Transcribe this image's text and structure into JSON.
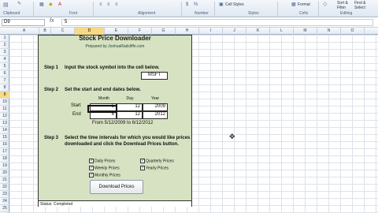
{
  "ribbon": {
    "groups": {
      "clipboard": "Clipboard",
      "font": "Font",
      "alignment": "Alignment",
      "number": "Number",
      "styles": "Styles",
      "cells": "Cells",
      "editing": "Editing"
    },
    "cell_styles": "Cell Styles",
    "format": "Format",
    "sort_filter": "Sort &\nFilter",
    "find_select": "Find &\nSelect"
  },
  "formula_bar": {
    "name_box": "D9",
    "fx": "fx",
    "value": "5"
  },
  "columns": [
    "A",
    "B",
    "C",
    "D",
    "E",
    "F",
    "G",
    "H",
    "I",
    "J",
    "K",
    "L",
    "M",
    "N",
    "O"
  ],
  "rows": [
    "1",
    "2",
    "3",
    "4",
    "5",
    "6",
    "7",
    "8",
    "9",
    "10",
    "11",
    "12",
    "13",
    "14",
    "15",
    "16",
    "17",
    "18",
    "19",
    "20",
    "21",
    "22",
    "23",
    "24",
    "25"
  ],
  "selected_column": "D",
  "selected_row": "9",
  "sheet": {
    "title": "Stock Price Downloader",
    "byline": "Prepared by JoshuaRadcliffe.com",
    "step1": {
      "label": "Step 1",
      "text": "Input the stock symbol into the cell below.",
      "symbol": "MSFT"
    },
    "step2": {
      "label": "Step 2",
      "text": "Set the start and end dates below.",
      "headers": {
        "month": "Month",
        "day": "Day",
        "year": "Year"
      },
      "start": {
        "label": "Start",
        "month": "5",
        "day": "12",
        "year": "2009"
      },
      "end": {
        "label": "End",
        "month": "6",
        "day": "12",
        "year": "2012"
      },
      "summary": "From 5/12/2009 to 6/12/2012"
    },
    "step3": {
      "label": "Step 3",
      "text": "Select the time intervals for which you would like prices downloaded and click the Download Prices button.",
      "options": [
        {
          "label": "Daily Prices",
          "checked": true
        },
        {
          "label": "Quarterly Prices",
          "checked": true
        },
        {
          "label": "Weekly Prices",
          "checked": true
        },
        {
          "label": "Yearly Prices",
          "checked": true
        },
        {
          "label": "Monthly Prices",
          "checked": true
        }
      ],
      "check_glyph": "✓",
      "button": "Download Prices"
    },
    "status": "Status: Completed"
  }
}
